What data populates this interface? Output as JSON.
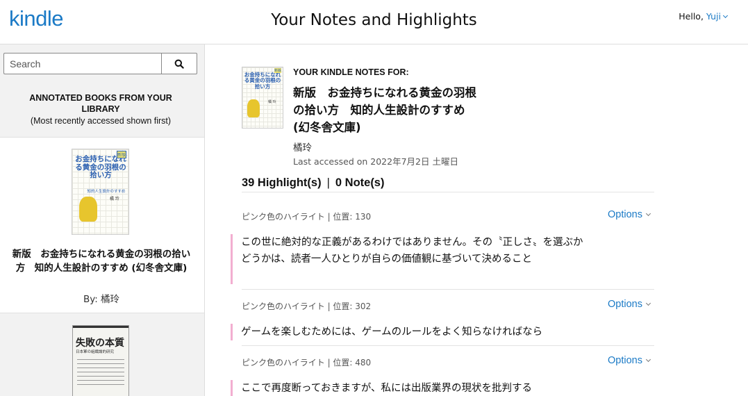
{
  "header": {
    "logo": "kindle",
    "title": "Your Notes and Highlights",
    "greeting": "Hello,",
    "user": "Yuji"
  },
  "sidebar": {
    "search_placeholder": "Search",
    "heading": "ANNOTATED BOOKS FROM YOUR LIBRARY",
    "subheading": "(Most recently accessed shown first)",
    "books": [
      {
        "title": "新版　お金持ちになれる黄金の羽根の拾い方　知的人生設計のすすめ (幻冬舎文庫)",
        "author": "By: 橘玲",
        "cover_title": "お金持ちになれる黄金の羽根の拾い方",
        "cover_badge": "新版",
        "cover_subtitle": "知的人生設計のすすめ",
        "cover_author": "橘 玲"
      },
      {
        "cover_title": "失敗の本質",
        "cover_subtitle": "日本軍の組織論的研究"
      }
    ]
  },
  "main": {
    "label_for": "YOUR KINDLE NOTES FOR:",
    "title": "新版　お金持ちになれる黄金の羽根の拾い方　知的人生設計のすすめ (幻冬舎文庫)",
    "author": "橘玲",
    "last_accessed": "Last accessed on 2022年7月2日 土曜日",
    "highlights_count": "39 Highlight(s)",
    "separator": "|",
    "notes_count": "0 Note(s)",
    "highlights": [
      {
        "meta": "ピンク色のハイライト | 位置: 130",
        "options": "Options",
        "text": "この世に絶対的な正義があるわけではありません。その〝正しさ〟を選ぶかどうかは、読者一人ひとりが自らの価値観に基づいて決めること"
      },
      {
        "meta": "ピンク色のハイライト | 位置: 302",
        "options": "Options",
        "text": "ゲームを楽しむためには、ゲームのルールをよく知らなければなら"
      },
      {
        "meta": "ピンク色のハイライト | 位置: 480",
        "options": "Options",
        "text": "ここで再度断っておきますが、私には出版業界の現状を批判する"
      }
    ]
  },
  "colors": {
    "accent": "#1b7ac6",
    "highlight_pink": "#f2aed0",
    "sidebar_bg": "#f2f2f2"
  }
}
